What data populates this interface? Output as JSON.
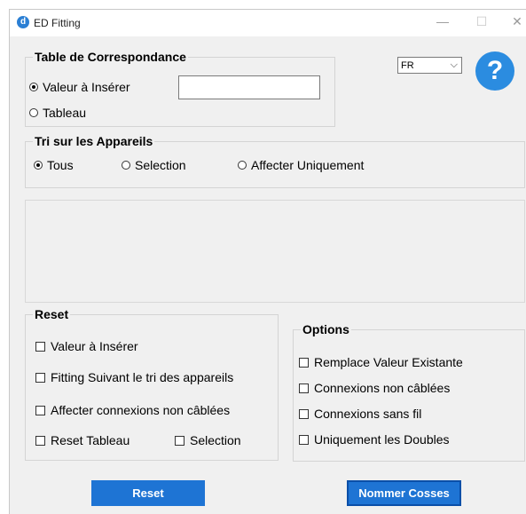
{
  "window": {
    "title": "ED Fitting",
    "icon_letter": "d",
    "minimize": "—",
    "maximize": "☐",
    "close": "✕"
  },
  "correspondance": {
    "title": "Table de Correspondance",
    "opt_valeur": "Valeur à Insérer",
    "opt_tableau": "Tableau",
    "valeur_input": ""
  },
  "language": {
    "selected": "FR",
    "chevron": "⌵"
  },
  "help": {
    "symbol": "?"
  },
  "tri": {
    "title": "Tri sur les Appareils",
    "opt_tous": "Tous",
    "opt_selection": "Selection",
    "opt_affecter": "Affecter Uniquement"
  },
  "reset_group": {
    "title": "Reset",
    "valeur": "Valeur à Insérer",
    "fitting": "Fitting Suivant le tri des appareils",
    "affecter": "Affecter connexions non câblées",
    "reset_tableau": "Reset Tableau",
    "selection": "Selection"
  },
  "options": {
    "title": "Options",
    "remplace": "Remplace Valeur Existante",
    "non_cablees": "Connexions non câblées",
    "sans_fil": "Connexions sans fil",
    "doubles": "Uniquement les Doubles"
  },
  "buttons": {
    "reset": "Reset",
    "nommer": "Nommer Cosses"
  }
}
